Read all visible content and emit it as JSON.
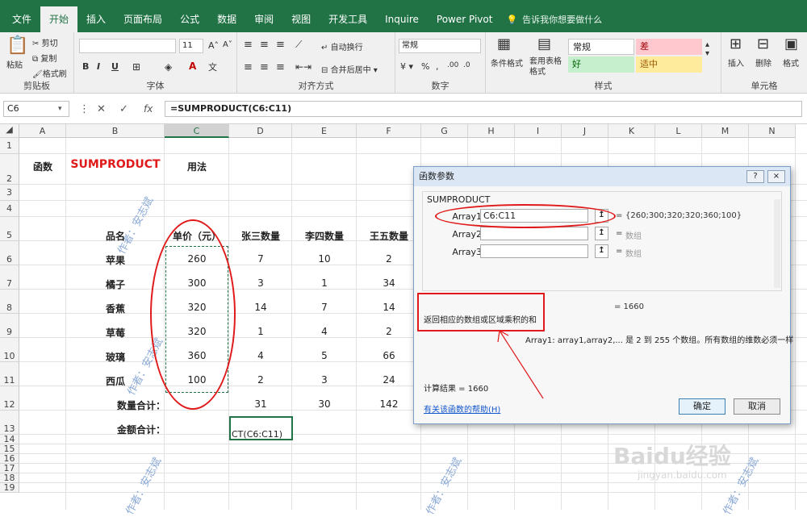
{
  "title_bar": {
    "tail": "Excel"
  },
  "tabs": [
    "文件",
    "开始",
    "插入",
    "页面布局",
    "公式",
    "数据",
    "审阅",
    "视图",
    "开发工具",
    "Inquire",
    "Power Pivot"
  ],
  "active_tab": "开始",
  "tellme": "告诉我你想要做什么",
  "ribbon": {
    "clipboard": {
      "label": "剪贴板",
      "paste": "粘贴",
      "cut": "剪切",
      "copy": "复制",
      "format_painter": "格式刷"
    },
    "font": {
      "label": "字体",
      "size": "11",
      "bold": "B",
      "italic": "I",
      "underline": "U"
    },
    "alignment": {
      "label": "对齐方式",
      "wrap": "自动换行",
      "merge": "合并后居中"
    },
    "number": {
      "label": "数字",
      "format": "常规"
    },
    "styles": {
      "label": "样式",
      "cond_format": "条件格式",
      "table_format": "套用表格格式",
      "s1": "常规",
      "s2": "差",
      "s3": "好",
      "s4": "适中"
    },
    "cells": {
      "label": "单元格",
      "insert": "插入",
      "delete": "删除",
      "format": "格式"
    }
  },
  "formula_bar": {
    "name_box": "C6",
    "formula": "=SUMPRODUCT(C6:C11)",
    "fx": "fx"
  },
  "columns": [
    "A",
    "B",
    "C",
    "D",
    "E",
    "F",
    "G",
    "H",
    "I",
    "J",
    "K",
    "L",
    "M",
    "N"
  ],
  "rows": [
    "1",
    "2",
    "3",
    "4",
    "5",
    "6",
    "7",
    "8",
    "9",
    "10",
    "11",
    "12",
    "13",
    "14",
    "15",
    "16",
    "17",
    "18",
    "19"
  ],
  "sheet": {
    "func_label": "函数",
    "func_name": "SUMPRODUCT",
    "usage_label": "用法",
    "headers": [
      "品名",
      "单价（元）",
      "张三数量",
      "李四数量",
      "王五数量"
    ],
    "items": [
      {
        "name": "苹果",
        "price": "260",
        "zs": "7",
        "ls": "10",
        "ww": "2"
      },
      {
        "name": "橘子",
        "price": "300",
        "zs": "3",
        "ls": "1",
        "ww": "34"
      },
      {
        "name": "香蕉",
        "price": "320",
        "zs": "14",
        "ls": "7",
        "ww": "14"
      },
      {
        "name": "草莓",
        "price": "320",
        "zs": "1",
        "ls": "4",
        "ww": "2"
      },
      {
        "name": "玻璃",
        "price": "360",
        "zs": "4",
        "ls": "5",
        "ww": "66"
      },
      {
        "name": "西瓜",
        "price": "100",
        "zs": "2",
        "ls": "3",
        "ww": "24"
      }
    ],
    "qty_total_label": "数量合计：",
    "qty_totals": [
      "31",
      "30",
      "142"
    ],
    "amount_total_label": "金额合计：",
    "editing_cell": "CT(C6:C11)",
    "watermark": "作者：安志斌"
  },
  "dialog": {
    "title": "函数参数",
    "help": "?",
    "close": "×",
    "function": "SUMPRODUCT",
    "args": [
      {
        "label": "Array1",
        "value": "C6:C11",
        "result": "{260;300;320;320;360;100}"
      },
      {
        "label": "Array2",
        "value": "",
        "result": "数组"
      },
      {
        "label": "Array3",
        "value": "",
        "result": "数组"
      }
    ],
    "picker": "↥",
    "eq": "=",
    "formula_result": "= 1660",
    "description": "返回相应的数组或区域乘积的和",
    "arg_description": "Array1:   array1,array2,... 是 2 到 255 个数组。所有数组的维数必须一样",
    "calc_result": "计算结果 =   1660",
    "help_link": "有关该函数的帮助(H)",
    "ok": "确定",
    "cancel": "取消"
  },
  "watermark_site": "Baidu经验",
  "watermark_url": "jingyan.baidu.com"
}
